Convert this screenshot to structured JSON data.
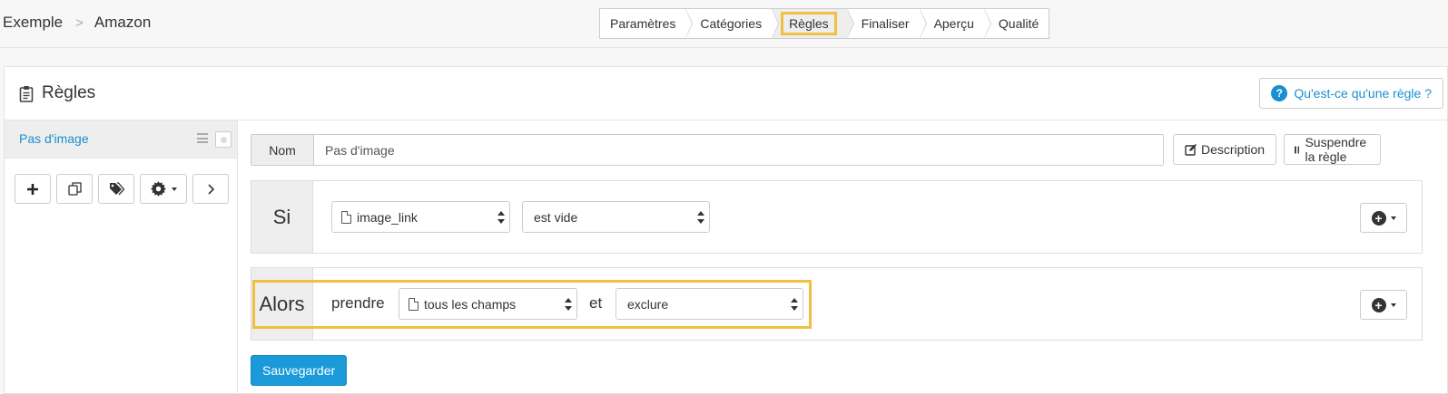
{
  "breadcrumb": {
    "root": "Exemple",
    "separator": ">",
    "current": "Amazon"
  },
  "steps": [
    {
      "label": "Paramètres",
      "active": false
    },
    {
      "label": "Catégories",
      "active": false
    },
    {
      "label": "Règles",
      "active": true
    },
    {
      "label": "Finaliser",
      "active": false
    },
    {
      "label": "Aperçu",
      "active": false
    },
    {
      "label": "Qualité",
      "active": false
    }
  ],
  "panel": {
    "title": "Règles",
    "help_label": "Qu'est-ce qu'une règle ?"
  },
  "sidebar": {
    "rules": [
      {
        "label": "Pas d'image"
      }
    ]
  },
  "rule": {
    "name_label": "Nom",
    "name_value": "Pas d'image",
    "description_label": "Description",
    "suspend_label": "Suspendre la règle",
    "if": {
      "label": "Si",
      "field": "image_link",
      "operator": "est vide"
    },
    "then": {
      "label": "Alors",
      "verb": "prendre",
      "field": "tous les champs",
      "conjunction": "et",
      "action": "exclure"
    },
    "save_label": "Sauvegarder"
  },
  "colors": {
    "accent": "#1a9ad9",
    "highlight": "#f0c040"
  }
}
